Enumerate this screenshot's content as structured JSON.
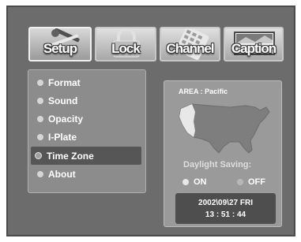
{
  "tabs": [
    {
      "label": "Setup",
      "icon": "wrench-screwdriver-icon",
      "active": true
    },
    {
      "label": "Lock",
      "icon": "padlock-icon",
      "active": false
    },
    {
      "label": "Channel",
      "icon": "remote-keypad-icon",
      "active": false
    },
    {
      "label": "Caption",
      "icon": "caption-screen-icon",
      "active": false
    }
  ],
  "menu": {
    "items": [
      "Format",
      "Sound",
      "Opacity",
      "I-Plate",
      "Time Zone",
      "About"
    ],
    "selected": "Time Zone"
  },
  "timezone": {
    "area_label": "AREA : Pacific",
    "map_icon": "us-map-icon",
    "daylight_saving_label": "Daylight Saving:",
    "on_label": "ON",
    "off_label": "OFF",
    "selected": "ON"
  },
  "clock": {
    "date": "2002\\09\\27   FRI",
    "time": "13 : 51 : 44"
  }
}
